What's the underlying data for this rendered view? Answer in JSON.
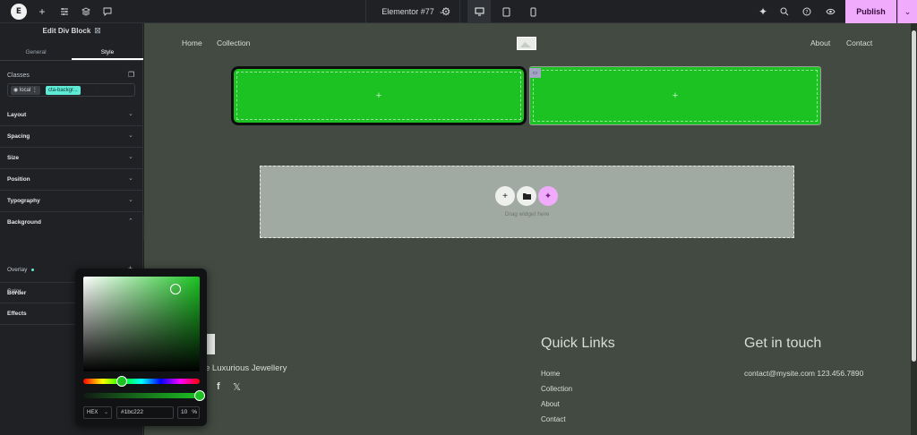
{
  "topbar": {
    "logo": "E",
    "doc_title": "Elementor #77",
    "publish": "Publish"
  },
  "panel": {
    "title": "Edit Div Block",
    "tabs": [
      "General",
      "Style"
    ],
    "classes_label": "Classes",
    "chip_local": "local",
    "chip_class": "cta-backgr...",
    "sections": [
      "Layout",
      "Spacing",
      "Size",
      "Position",
      "Typography",
      "Background",
      "Border",
      "Effects"
    ],
    "overlay_label": "Overlay",
    "color_label": "Color",
    "color_value": "#1bc222"
  },
  "canvas": {
    "nav": [
      "Home",
      "Collection",
      "About",
      "Contact"
    ],
    "drop_hint": "Drag widget here",
    "footer_tagline": "e Luxurious Jewellery",
    "quick_links_title": "Quick Links",
    "quick_links": [
      "Home",
      "Collection",
      "About",
      "Contact"
    ],
    "contact_title": "Get in touch",
    "contact_line": "contact@mysite.com 123.456.7890"
  },
  "picker": {
    "format": "HEX",
    "hex": "#1bc222",
    "alpha": "10",
    "alpha_unit": "%"
  },
  "colors": {
    "accent_green": "#1bc222",
    "publish_pink": "#f0abfc",
    "class_chip": "#5eead4"
  }
}
